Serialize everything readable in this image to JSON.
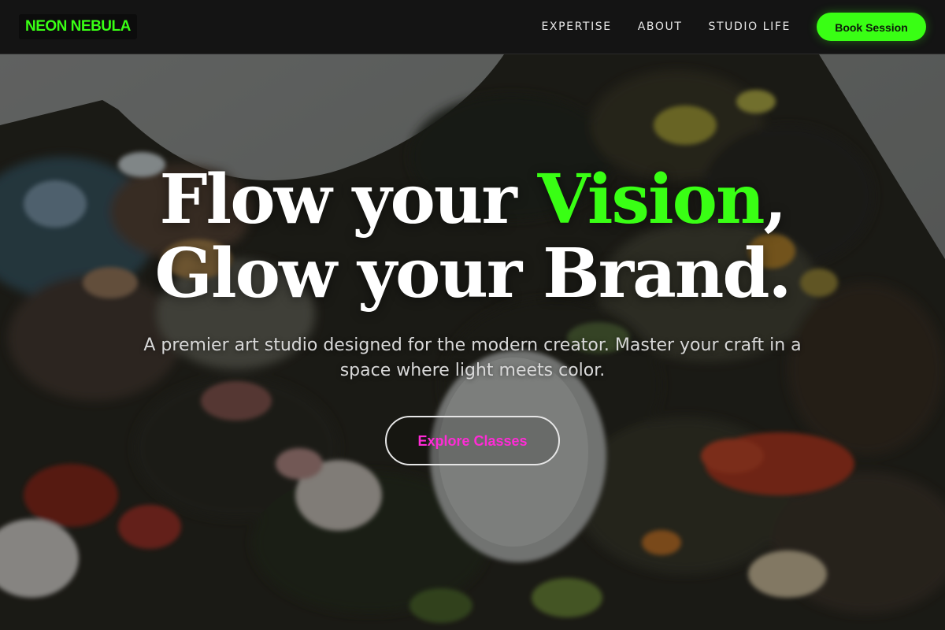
{
  "brand": {
    "name": "NEON NEBULA"
  },
  "nav": {
    "links": [
      {
        "label": "EXPERTISE"
      },
      {
        "label": "ABOUT"
      },
      {
        "label": "STUDIO LIFE"
      }
    ],
    "cta_label": "Book Session"
  },
  "hero": {
    "headline_line1_before": "Flow your ",
    "headline_line1_accent": "Vision",
    "headline_line1_after": ",",
    "headline_line2": "Glow your Brand.",
    "subtext": "A premier art studio designed for the modern creator. Master your craft in a space where light meets color.",
    "button_label": "Explore Classes"
  },
  "colors": {
    "accent_green": "#39ff14",
    "accent_magenta": "#ff2bd6",
    "nav_background": "#141414",
    "headline": "#ffffff"
  },
  "icons": {
    "hero_image": "paint-palette-photo"
  }
}
